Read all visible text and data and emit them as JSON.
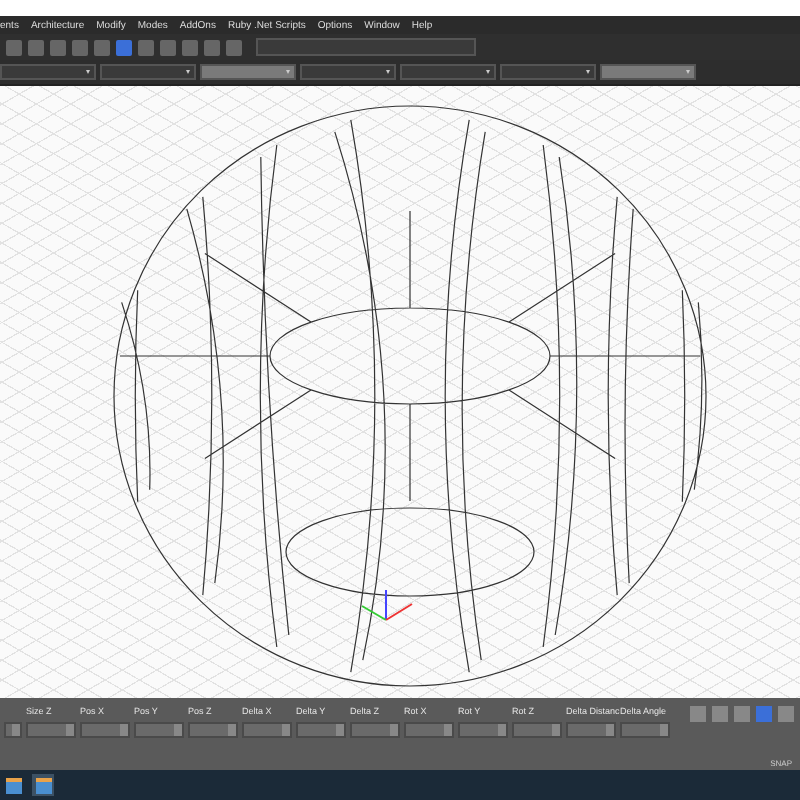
{
  "menu": [
    {
      "label": "ents"
    },
    {
      "label": "Architecture"
    },
    {
      "label": "Modify"
    },
    {
      "label": "Modes"
    },
    {
      "label": "AddOns"
    },
    {
      "label": "Ruby .Net Scripts"
    },
    {
      "label": "Options"
    },
    {
      "label": "Window"
    },
    {
      "label": "Help"
    }
  ],
  "toolbar": {
    "tools": [
      {
        "kind": "plain"
      },
      {
        "kind": "plain"
      },
      {
        "kind": "plain"
      },
      {
        "kind": "plain"
      },
      {
        "kind": "plain"
      },
      {
        "kind": "active"
      },
      {
        "kind": "plain"
      },
      {
        "kind": "plain"
      },
      {
        "kind": "plain"
      },
      {
        "kind": "plain"
      },
      {
        "kind": "plain"
      }
    ]
  },
  "dropdowns": [
    {
      "kind": "dark"
    },
    {
      "kind": "dark"
    },
    {
      "kind": "light"
    },
    {
      "kind": "dark"
    },
    {
      "kind": "dark"
    },
    {
      "kind": "dark"
    },
    {
      "kind": "light"
    }
  ],
  "properties": [
    {
      "label": "Size Z"
    },
    {
      "label": "Pos X"
    },
    {
      "label": "Pos Y"
    },
    {
      "label": "Pos Z"
    },
    {
      "label": "Delta X"
    },
    {
      "label": "Delta Y"
    },
    {
      "label": "Delta Z"
    },
    {
      "label": "Rot X"
    },
    {
      "label": "Rot Y"
    },
    {
      "label": "Rot Z"
    },
    {
      "label": "Delta Distanc"
    },
    {
      "label": "Delta Angle"
    }
  ],
  "status_bar": {
    "snap": "SNAP"
  },
  "taskbar": {
    "apps": [
      {
        "selected": false
      },
      {
        "selected": true
      }
    ]
  }
}
